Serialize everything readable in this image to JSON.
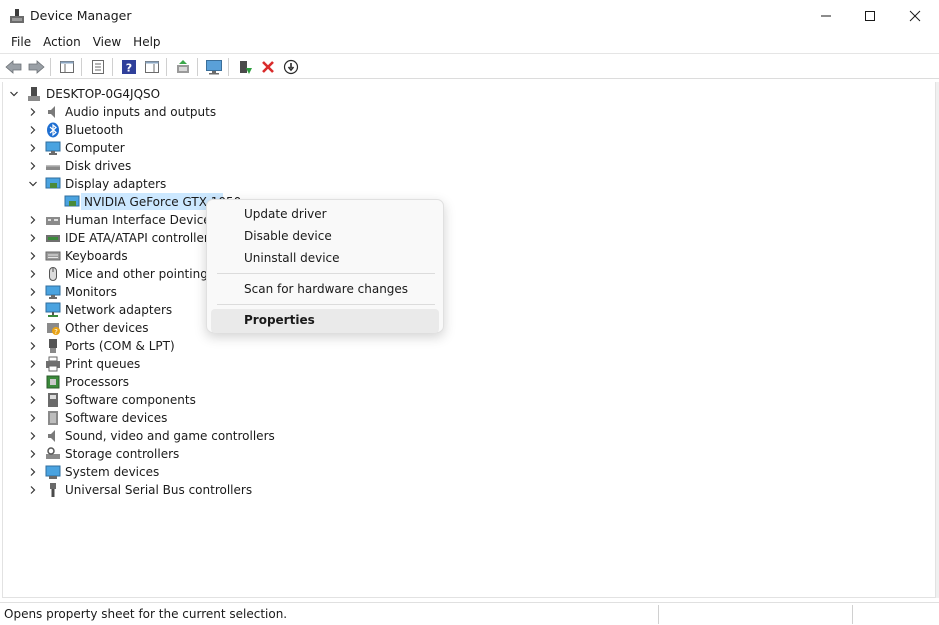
{
  "window": {
    "title": "Device Manager"
  },
  "menu": [
    "File",
    "Action",
    "View",
    "Help"
  ],
  "toolbar": {
    "buttons": [
      "back-icon",
      "forward-icon",
      "show-hide-tree-icon",
      "properties-icon",
      "help-icon",
      "action-pane-icon",
      "update-driver-icon",
      "monitor-icon",
      "enable-device-icon",
      "uninstall-icon",
      "download-icon"
    ]
  },
  "tree": {
    "root": "DESKTOP-0G4JQSO",
    "categories": [
      "Audio inputs and outputs",
      "Bluetooth",
      "Computer",
      "Disk drives",
      "Display adapters",
      "Human Interface Devices",
      "IDE ATA/ATAPI controllers",
      "Keyboards",
      "Mice and other pointing de",
      "Monitors",
      "Network adapters",
      "Other devices",
      "Ports (COM & LPT)",
      "Print queues",
      "Processors",
      "Software components",
      "Software devices",
      "Sound, video and game controllers",
      "Storage controllers",
      "System devices",
      "Universal Serial Bus controllers"
    ],
    "selected_child": "NVIDIA GeForce GTX 1050"
  },
  "context_menu": {
    "items": [
      "Update driver",
      "Disable device",
      "Uninstall device",
      "Scan for hardware changes",
      "Properties"
    ]
  },
  "status": {
    "text": "Opens property sheet for the current selection."
  },
  "colors": {
    "selection": "#cce8ff",
    "accent_red": "#d92b2b"
  }
}
